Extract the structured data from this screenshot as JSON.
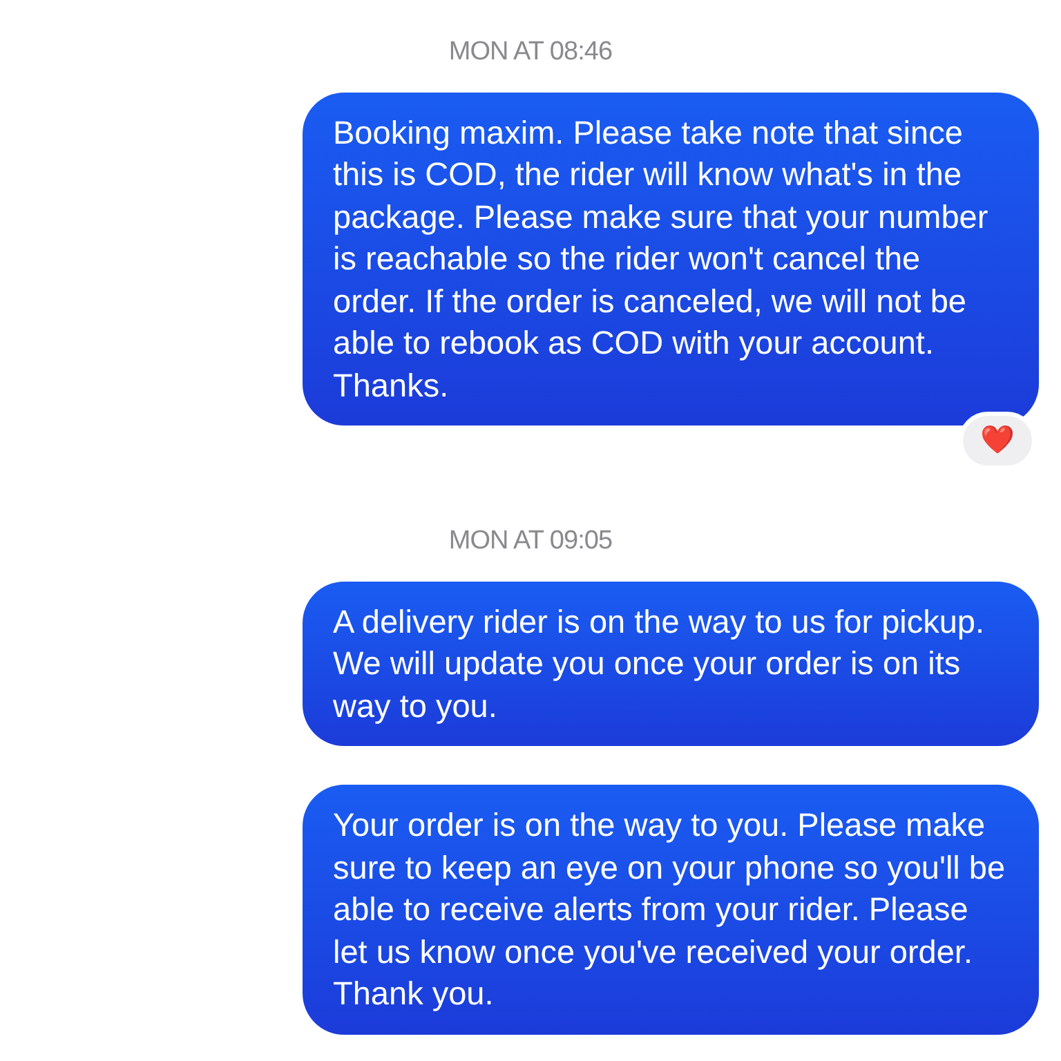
{
  "messages": [
    {
      "kind": "timestamp",
      "text": "MON AT 08:46"
    },
    {
      "kind": "bubble",
      "text": "Booking maxim. Please take note that since this is COD, the rider will know what's in the package. Please make sure that your number is reachable so the rider won't cancel the order. If the order is canceled, we will not be able to rebook as COD with your account. Thanks.",
      "reaction": "❤️"
    },
    {
      "kind": "timestamp",
      "text": "MON AT 09:05"
    },
    {
      "kind": "bubble",
      "text": "A delivery rider is on the way to us for pickup. We will update you once your order is on its way to you."
    },
    {
      "kind": "bubble",
      "text": "Your order is on the way to you. Please make sure to keep an eye on your phone so you'll be able to receive alerts from your rider. Please let us know once you've received your order. Thank you."
    }
  ]
}
